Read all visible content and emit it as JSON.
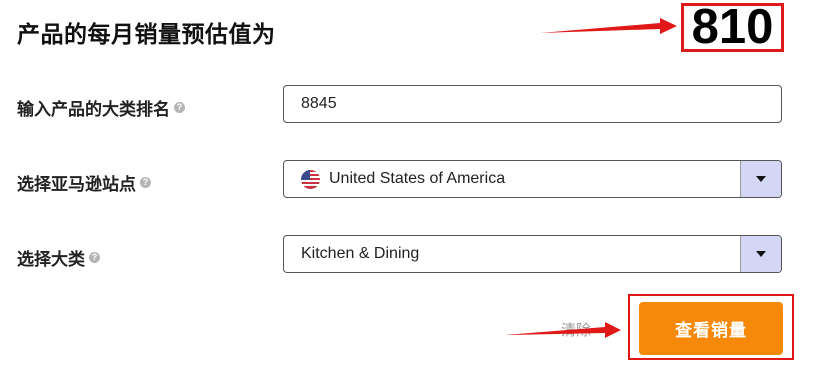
{
  "header": {
    "title": "产品的每月销量预估值为",
    "result": "810"
  },
  "form": {
    "rank": {
      "label": "输入产品的大类排名",
      "value": "8845"
    },
    "site": {
      "label": "选择亚马逊站点",
      "value": "United States of America",
      "flag_icon": "us-flag-icon"
    },
    "category": {
      "label": "选择大类",
      "value": "Kitchen & Dining"
    },
    "help_glyph": "?"
  },
  "actions": {
    "clear_label": "清除",
    "submit_label": "查看销量"
  },
  "colors": {
    "accent": "#f7890a",
    "annotation": "#e01818",
    "dropdown": "#d4d6f6"
  }
}
